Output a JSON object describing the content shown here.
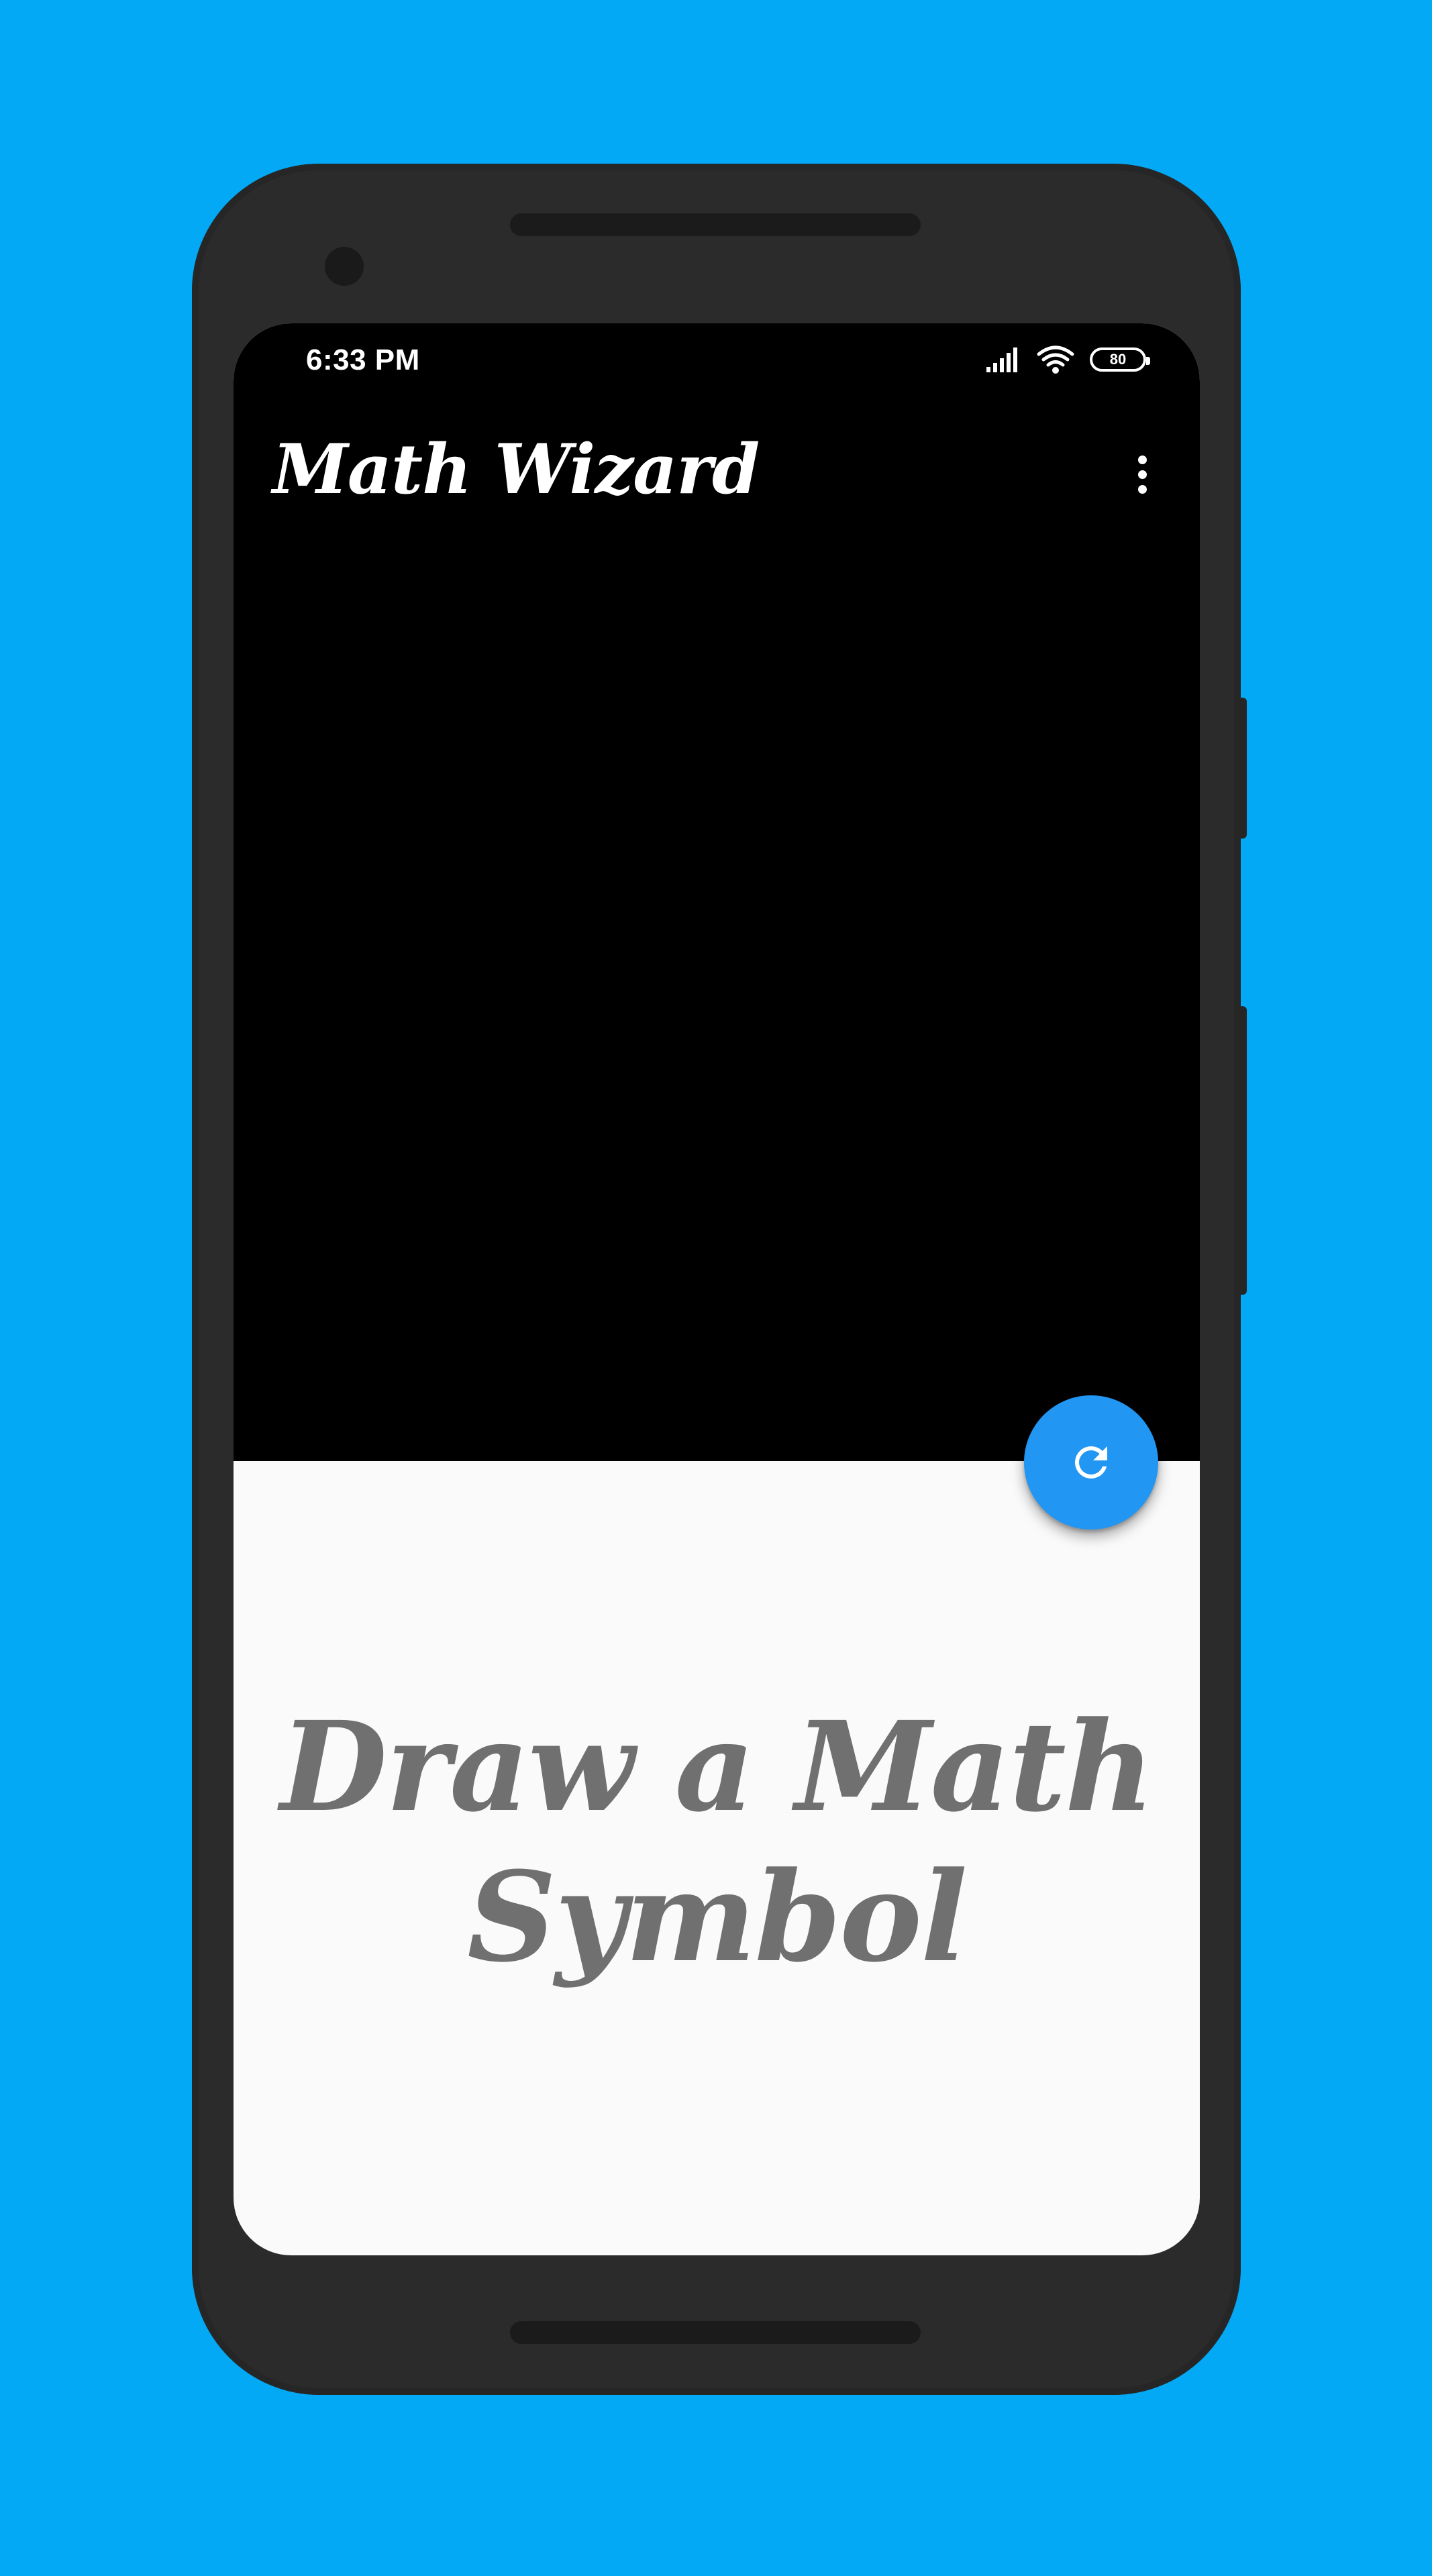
{
  "status_bar": {
    "time": "6:33 PM",
    "battery_level": "80",
    "icons": [
      "signal-icon",
      "wifi-icon",
      "battery-icon"
    ]
  },
  "app_bar": {
    "title": "Math Wizard",
    "menu_icon": "more-vert-icon"
  },
  "fab": {
    "icon": "refresh-icon",
    "color": "#2196f3"
  },
  "prompt": {
    "line1": "Draw a Math",
    "line2": "Symbol"
  },
  "colors": {
    "background": "#03a9f4",
    "canvas": "#000000",
    "panel": "#fafafa",
    "prompt_text": "#707070"
  }
}
